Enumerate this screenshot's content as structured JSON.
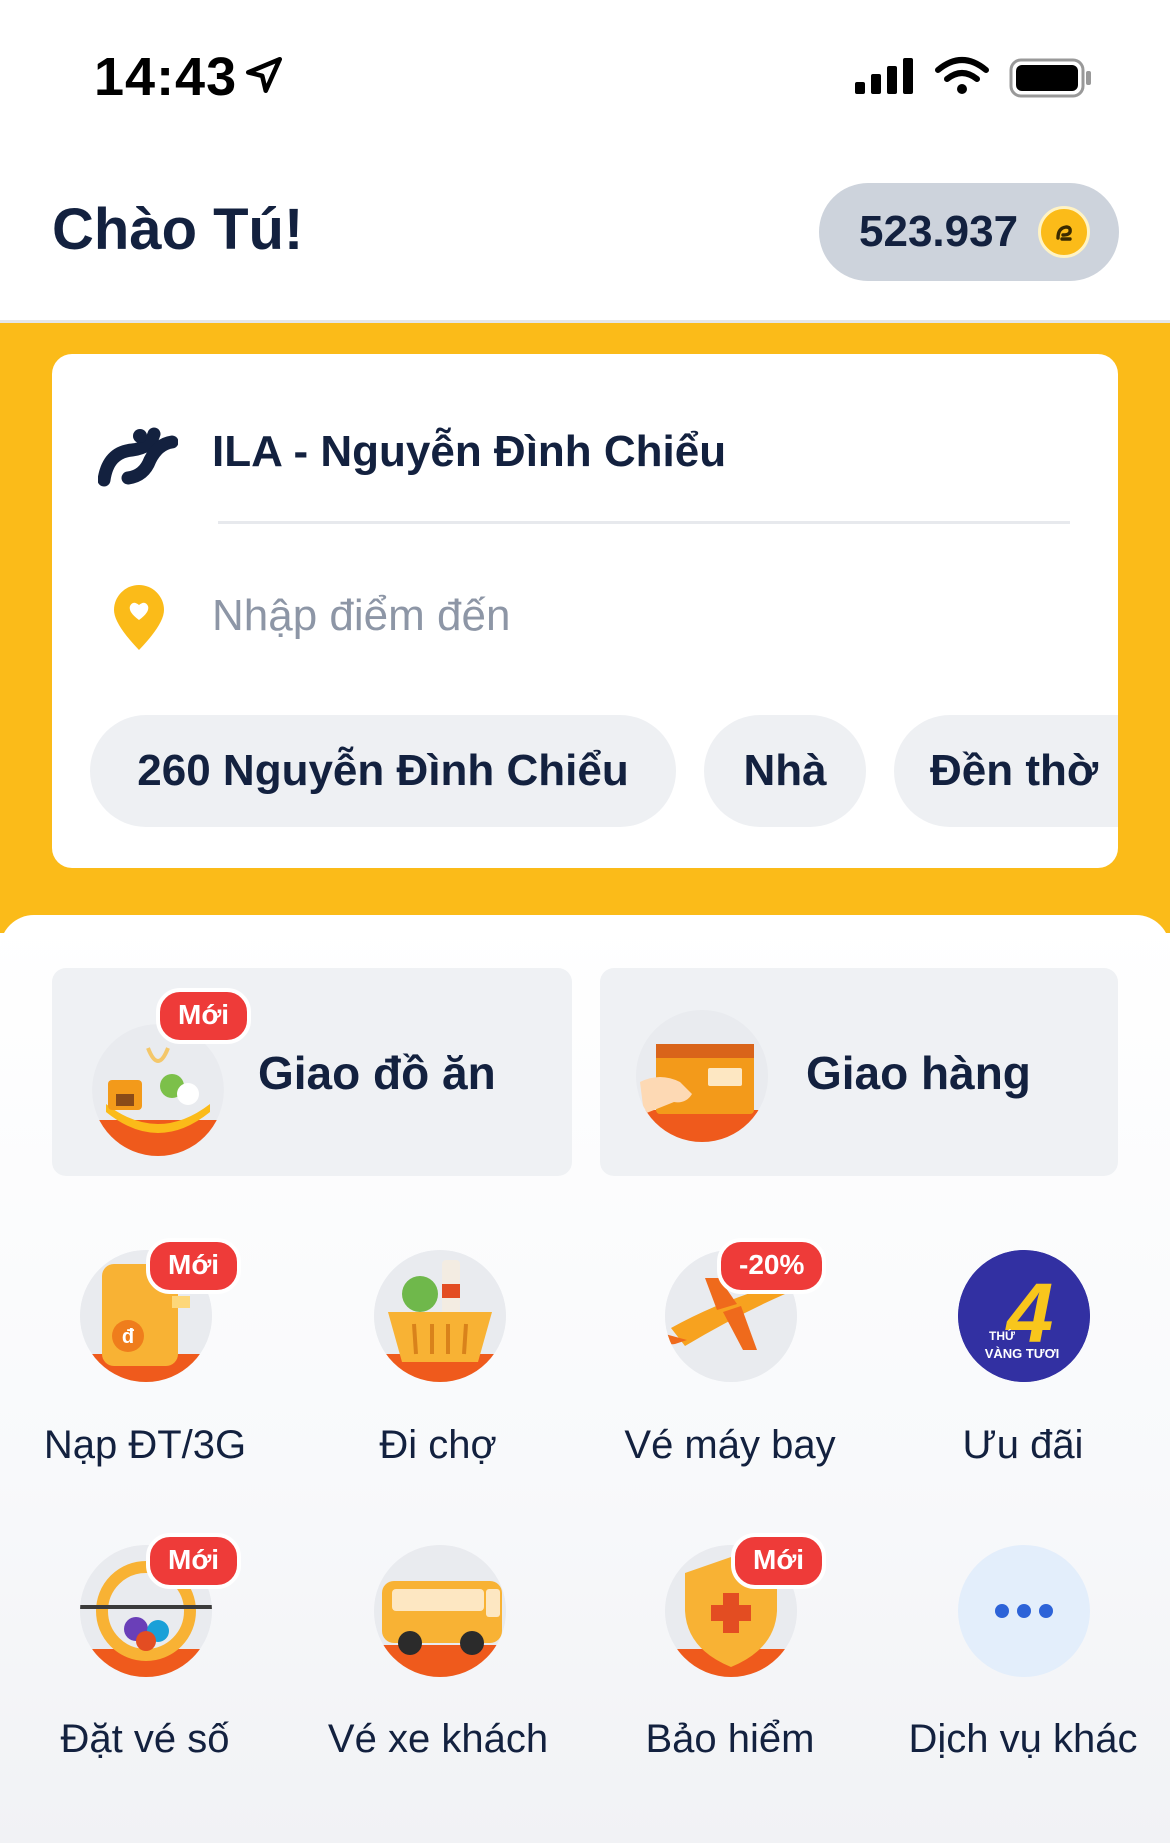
{
  "status_bar": {
    "time": "14:43"
  },
  "header": {
    "greeting": "Chào Tú!",
    "coins": "523.937"
  },
  "booking": {
    "pickup": "ILA - Nguyễn Đình Chiểu",
    "destination_placeholder": "Nhập điểm đến",
    "chips": [
      "260 Nguyễn Đình Chiểu",
      "Nhà",
      "Đền thờ"
    ]
  },
  "main_services": [
    {
      "label": "Giao đồ ăn",
      "badge": "Mới"
    },
    {
      "label": "Giao hàng"
    }
  ],
  "services": [
    {
      "label": "Nạp ĐT/3G",
      "badge": "Mới"
    },
    {
      "label": "Đi chợ"
    },
    {
      "label": "Vé máy bay",
      "badge": "-20%"
    },
    {
      "label": "Ưu đãi",
      "icon_text_top": "THỨ",
      "icon_text_bottom": "VÀNG TƯƠI",
      "icon_number": "4"
    },
    {
      "label": "Đặt vé số",
      "badge": "Mới"
    },
    {
      "label": "Vé xe khách"
    },
    {
      "label": "Bảo hiểm",
      "badge": "Mới"
    },
    {
      "label": "Dịch vụ khác"
    }
  ],
  "colors": {
    "brand_yellow": "#fbbb19",
    "navy": "#13213f",
    "badge_red": "#ee3b39"
  }
}
